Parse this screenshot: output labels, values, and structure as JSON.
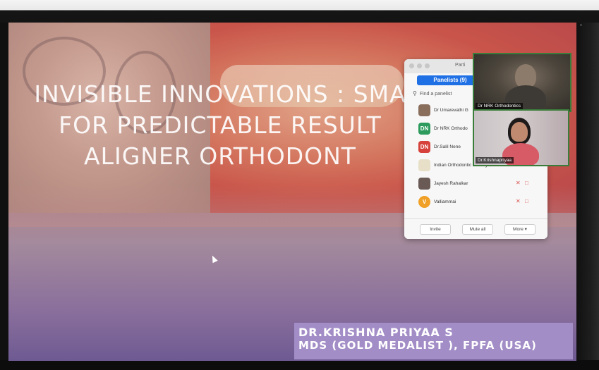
{
  "slide": {
    "title_lines": [
      "INVISIBLE INNOVATIONS : SMA",
      "FOR PREDICTABLE RESULT",
      "ALIGNER ORTHODONT"
    ],
    "presenter_name": "DR.KRISHNA PRIYAA S",
    "presenter_credentials": "MDS (GOLD MEDALIST ), FPFA (USA)"
  },
  "participants_window": {
    "title": "Parti",
    "panelists_tab": "Panelists (9)",
    "search_placeholder": "Find a panelist",
    "search_icon": "search-icon",
    "rows": [
      {
        "avatar_initials": "",
        "avatar_color": "#8a6e5c",
        "name": "Dr Umarevathi G",
        "muted": false
      },
      {
        "avatar_initials": "DN",
        "avatar_color": "#2e9b5e",
        "name": "Dr NRK Orthodo",
        "muted": false
      },
      {
        "avatar_initials": "DN",
        "avatar_color": "#d6413b",
        "name": "Dr.Salil Nene",
        "muted": false
      },
      {
        "avatar_initials": "",
        "avatar_color": "#e8dfc9",
        "name": "Indian Orthodontic Society",
        "muted": true
      },
      {
        "avatar_initials": "",
        "avatar_color": "#6a5a55",
        "name": "Jayesh Rahalkar",
        "muted": true
      },
      {
        "avatar_initials": "V",
        "avatar_color": "#f0a026",
        "name": "Valliammai",
        "muted": true
      }
    ],
    "buttons": {
      "invite": "Invite",
      "mute_all": "Mute all",
      "more": "More ▾"
    }
  },
  "video_tiles": [
    {
      "label": "Dr NRK Orthodontics"
    },
    {
      "label": "Dr.Krishnapriyaa"
    }
  ],
  "colors": {
    "panelists_accent": "#1f6fe5",
    "presenter_box": "#a38dc7",
    "muted_icon": "#d9534f"
  }
}
